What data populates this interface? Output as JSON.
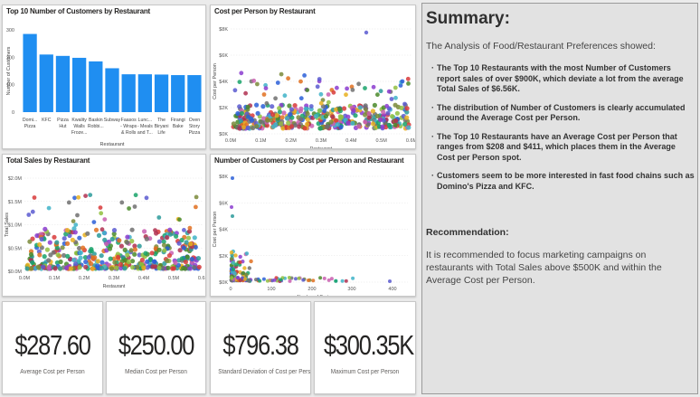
{
  "charts": {
    "top10": {
      "title": "Top 10 Number of Customers by Restaurant",
      "xlabel": "Restaurant",
      "ylabel": "Number of Customers",
      "yticks": [
        "300",
        "200",
        "100",
        "0"
      ]
    },
    "cost": {
      "title": "Cost per Person by Restaurant",
      "xlabel": "Restaurant",
      "ylabel": "Cost per Person",
      "xticks": [
        "0.0M",
        "0.1M",
        "0.2M",
        "0.3M",
        "0.4M",
        "0.5M",
        "0.6M"
      ],
      "yticks": [
        "$8K",
        "$6K",
        "$4K",
        "$2K",
        "$0K"
      ]
    },
    "sales": {
      "title": "Total Sales by Restaurant",
      "xlabel": "Restaurant",
      "ylabel": "Total Sales",
      "xticks": [
        "0.0M",
        "0.1M",
        "0.2M",
        "0.3M",
        "0.4M",
        "0.5M",
        "0.6M"
      ],
      "yticks": [
        "$2.0M",
        "$1.5M",
        "$1.0M",
        "$0.5M",
        "$0.0M"
      ]
    },
    "customers": {
      "title": "Number of Customers by Cost per Person and Restaurant",
      "xlabel": "Number of Customers",
      "ylabel": "Cost per Person",
      "xticks": [
        "0",
        "100",
        "200",
        "300",
        "400"
      ],
      "yticks": [
        "$8K",
        "$6K",
        "$4K",
        "$2K",
        "$0K"
      ]
    }
  },
  "chart_data": [
    {
      "type": "bar",
      "title": "Top 10 Number of Customers by Restaurant",
      "xlabel": "Restaurant",
      "ylabel": "Number of Customers",
      "ylim": [
        0,
        300
      ],
      "categories": [
        [
          "Domi...",
          "Pizza"
        ],
        [
          "KFC"
        ],
        [
          "Pizza",
          "Hut"
        ],
        [
          "Kwality",
          "Walls",
          "Froze..."
        ],
        [
          "Baskin",
          "Robbi..."
        ],
        [
          "Subway"
        ],
        [
          "Faasos",
          "- Wraps",
          "& Rolls"
        ],
        [
          "Lunc...",
          "- Meals",
          "and T..."
        ],
        [
          "The",
          "Biryani",
          "Life"
        ],
        [
          "Firangi",
          "Bake"
        ],
        [
          "Oven",
          "Story",
          "Pizza"
        ]
      ],
      "values": [
        285,
        210,
        205,
        198,
        185,
        160,
        138,
        138,
        137,
        135,
        135
      ],
      "color": "#1f8ef1"
    },
    {
      "type": "scatter",
      "title": "Cost per Person by Restaurant",
      "xlabel": "Restaurant",
      "ylabel": "Cost per Person",
      "xlim": [
        0,
        0.6
      ],
      "ylim": [
        0,
        8000
      ],
      "note": "dense multi-colored scatter; most points between $0K and $2K"
    },
    {
      "type": "scatter",
      "title": "Total Sales by Restaurant",
      "xlabel": "Restaurant",
      "ylabel": "Total Sales",
      "xlim": [
        0,
        0.6
      ],
      "ylim": [
        0,
        2000000
      ]
    },
    {
      "type": "scatter",
      "title": "Number of Customers by Cost per Person and Restaurant",
      "xlabel": "Number of Customers",
      "ylabel": "Cost per Person",
      "xlim": [
        0,
        450
      ],
      "ylim": [
        0,
        8000
      ]
    }
  ],
  "kpis": [
    {
      "value": "$287.60",
      "label": "Average Cost per Person"
    },
    {
      "value": "$250.00",
      "label": "Median Cost per Person"
    },
    {
      "value": "$796.38",
      "label": "Standard Deviation of Cost per Person"
    },
    {
      "value": "$300.35K",
      "label": "Maximum Cost per Person"
    }
  ],
  "summary": {
    "title": "Summary:",
    "intro": "The Analysis of Food/Restaurant Preferences showed:",
    "bullets": [
      "The Top 10 Restaurants with the most Number of Customers report sales of over $900K, which deviate a lot from the average Total Sales of $6.56K.",
      "The distribution of Number of Customers is clearly accumulated around the Average Cost per Person.",
      "The Top 10 Restaurants have an Average Cost per Person that ranges from $208 and $411, which places them in the Average Cost per Person spot.",
      "Customers seem to be more interested in fast food chains such as Domino's Pizza and KFC."
    ],
    "rec_title": "Recommendation:",
    "rec_text": "It is recommended to focus marketing campaigns on restaurants with Total Sales above $500K and within the Average Cost per Person."
  },
  "colors": {
    "bar": "#1f8ef1",
    "palette": [
      "#8b3ccf",
      "#2b5fd8",
      "#19a36a",
      "#e8b020",
      "#d83a3a",
      "#3fb3c8",
      "#7a8a3a",
      "#c95fb0",
      "#4a8a2a",
      "#e07020",
      "#5a5ad0",
      "#2a9a9a",
      "#b03050",
      "#90c040",
      "#707070"
    ]
  }
}
